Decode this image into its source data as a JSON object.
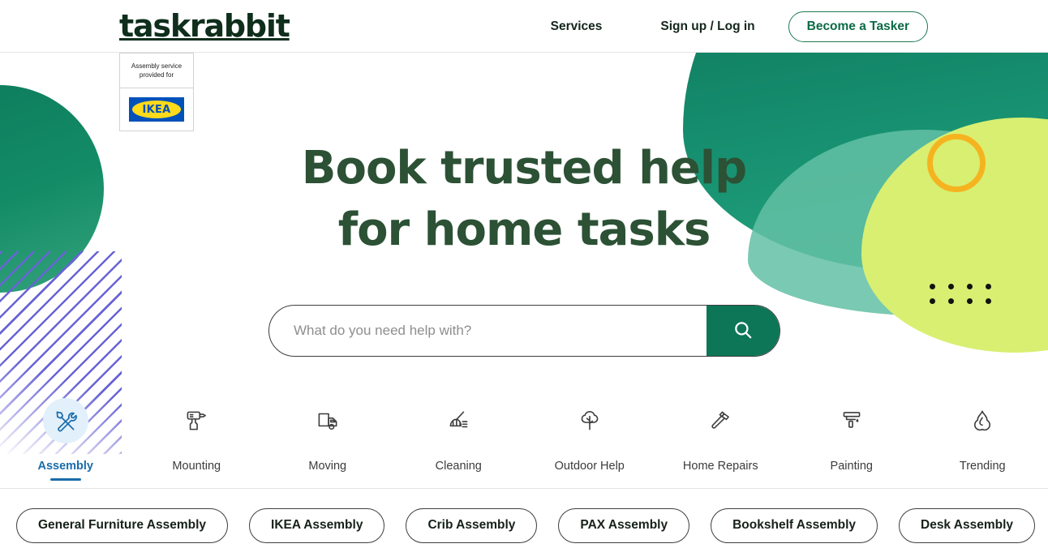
{
  "header": {
    "logo": "taskrabbit",
    "nav": [
      {
        "label": "Services",
        "name": "nav-services"
      },
      {
        "label": "Sign up / Log in",
        "name": "nav-signup-login"
      }
    ],
    "cta_label": "Become a Tasker"
  },
  "badge": {
    "line1": "Assembly service",
    "line2": "provided for",
    "brand": "IKEA"
  },
  "hero": {
    "headline_line1": "Book trusted help",
    "headline_line2": "for home tasks"
  },
  "search": {
    "placeholder": "What do you need help with?",
    "value": "",
    "icon": "search-icon",
    "button_label": ""
  },
  "categories": [
    {
      "label": "Assembly",
      "icon": "tools-icon",
      "active": true
    },
    {
      "label": "Mounting",
      "icon": "drill-icon",
      "active": false
    },
    {
      "label": "Moving",
      "icon": "moving-truck-icon",
      "active": false
    },
    {
      "label": "Cleaning",
      "icon": "broom-icon",
      "active": false
    },
    {
      "label": "Outdoor Help",
      "icon": "tree-icon",
      "active": false
    },
    {
      "label": "Home Repairs",
      "icon": "hammer-icon",
      "active": false
    },
    {
      "label": "Painting",
      "icon": "paint-roller-icon",
      "active": false
    },
    {
      "label": "Trending",
      "icon": "flame-icon",
      "active": false
    }
  ],
  "chips": [
    "General Furniture Assembly",
    "IKEA Assembly",
    "Crib Assembly",
    "PAX Assembly",
    "Bookshelf Assembly",
    "Desk Assembly"
  ],
  "colors": {
    "brand_green": "#0c7657",
    "headline_green": "#2c5135",
    "circle_green": "#138c66",
    "lime": "#d8ef72",
    "teal_light": "#63bfa4",
    "ring_yellow": "#f5b41f",
    "stripe_purple": "#6a63d6",
    "active_blue": "#1a6cab",
    "ikea_blue": "#0051ba",
    "ikea_yellow": "#ffda1a"
  }
}
